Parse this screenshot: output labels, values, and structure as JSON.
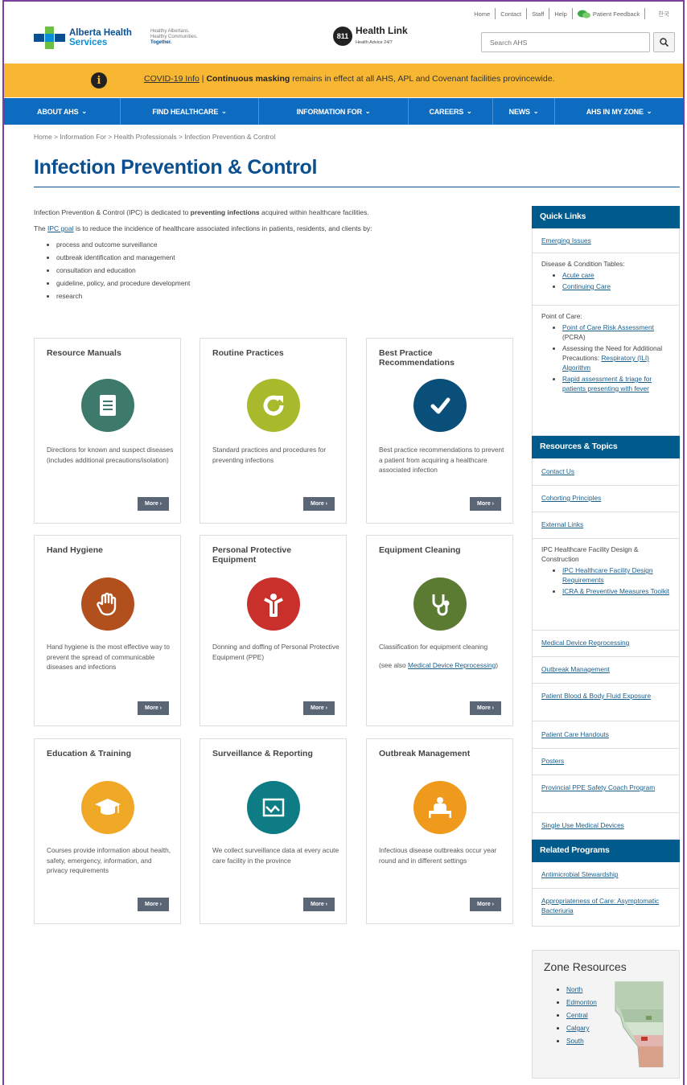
{
  "utility": {
    "links": [
      "Home",
      "Contact",
      "Staff",
      "Help"
    ],
    "feedback": "Patient Feedback",
    "language": "한국"
  },
  "header": {
    "logo_line1": "Alberta Health",
    "logo_line2": "Services",
    "tagline1": "Healthy Albertans.",
    "tagline2": "Healthy Communities.",
    "tagline3": "Together.",
    "healthlink_num": "811",
    "healthlink_title": "Health Link",
    "healthlink_sub": "Health Advice 24/7",
    "search_placeholder": "Search AHS"
  },
  "banner": {
    "link": "COVID-19 Info",
    "sep": " | ",
    "bold": "Continuous masking",
    "rest": " remains in effect at all AHS, APL and Covenant facilities provincewide."
  },
  "nav": [
    {
      "label": "ABOUT AHS"
    },
    {
      "label": "FIND HEALTHCARE"
    },
    {
      "label": "INFORMATION FOR"
    },
    {
      "label": "CAREERS"
    },
    {
      "label": "NEWS"
    },
    {
      "label": "AHS IN MY ZONE"
    }
  ],
  "breadcrumb": "Home > Information For > Health Professionals > Infection Prevention & Control",
  "page_title": "Infection Prevention & Control",
  "intro": {
    "p1_a": "Infection Prevention & Control (IPC) is dedicated to ",
    "p1_b": "preventing infections",
    "p1_c": " acquired within healthcare facilities.",
    "p2_a": "The ",
    "p2_link": "IPC goal",
    "p2_b": " is to reduce the incidence of healthcare associated infections in patients, residents, and clients by:",
    "bullets": [
      "process and outcome surveillance",
      "outbreak identification and management",
      "consultation and education",
      "guideline, policy, and procedure development",
      "research"
    ]
  },
  "more_label": "More ›",
  "cards": [
    {
      "title": "Resource Manuals",
      "desc": "Directions for known and suspect diseases (includes additional precautions/isolation)",
      "icon": "manual-icon",
      "color": "#3d7a6b"
    },
    {
      "title": "Routine Practices",
      "desc": "Standard practices and procedures for preventing infections",
      "icon": "refresh-icon",
      "color": "#a8b92c"
    },
    {
      "title": "Best Practice Recommendations",
      "desc": "Best practice recommendations to prevent a patient from acquiring a healthcare associated infection",
      "icon": "checkmark-icon",
      "color": "#0a4f7a"
    },
    {
      "title": "Hand Hygiene",
      "desc": "Hand hygiene is the most effective way to prevent the spread of communicable diseases and infections",
      "icon": "hand-icon",
      "color": "#b1501d"
    },
    {
      "title": "Personal Protective Equipment",
      "desc": "Donning and doffing of Personal Protective Equipment (PPE)",
      "icon": "person-icon",
      "color": "#c9302c"
    },
    {
      "title": "Equipment Cleaning",
      "desc": "Classification for equipment cleaning",
      "desc2": "(see also ",
      "desc_link": "Medical Device Reprocessing",
      "desc3": ")",
      "icon": "stethoscope-icon",
      "color": "#5b7a32"
    },
    {
      "title": "Education & Training",
      "desc": "Courses provide information about health, safety, emergency, information, and privacy requirements",
      "icon": "graduation-cap-icon",
      "color": "#f0a926"
    },
    {
      "title": "Surveillance & Reporting",
      "desc": "We collect surveillance data at every acute care facility in the province",
      "icon": "chart-monitor-icon",
      "color": "#0e7c84"
    },
    {
      "title": "Outbreak Management",
      "desc": "Infectious disease outbreaks occur year round and in different settings",
      "icon": "patient-bed-icon",
      "color": "#ef9a1d"
    }
  ],
  "sidebar": {
    "quick_links": "Quick Links",
    "emerging": "Emerging Issues",
    "disease_tables": "Disease & Condition Tables:",
    "acute": "Acute care",
    "continuing": "Continuing Care",
    "point_of_care": "Point of Care:",
    "pcra_link": "Point of Care Risk Assessment",
    "pcra_suffix": " (PCRA)",
    "ili_text": "Assessing the Need for Additional Precautions: ",
    "ili_link": "Respiratory (ILI) Algorithm",
    "rapid": "Rapid assessment & triage for patients presenting with fever",
    "resources_topics": "Resources & Topics",
    "contact": "Contact Us",
    "cohorting": "Cohorting Principles",
    "external": "External Links",
    "facility_design": "IPC Healthcare Facility Design & Construction",
    "design_req": "IPC Healthcare Facility Design Requirements",
    "icra": "ICRA & Preventive Measures Toolkit",
    "device_reproc": "Medical Device Reprocessing",
    "outbreak": "Outbreak Management",
    "blood": "Patient Blood & Body Fluid Exposure",
    "handouts": "Patient Care Handouts",
    "posters": "Posters",
    "ppe_coach": "Provincial PPE Safety Coach Program",
    "single_use": "Single Use Medical Devices",
    "related": "Related Programs",
    "antimicrobial": "Antimicrobial Stewardship",
    "appropriateness": "Appropriateness of Care: Asymptomatic Bacteriuria"
  },
  "zone": {
    "title": "Zone Resources",
    "items": [
      "North",
      "Edmonton",
      "Central",
      "Calgary",
      "South"
    ]
  }
}
